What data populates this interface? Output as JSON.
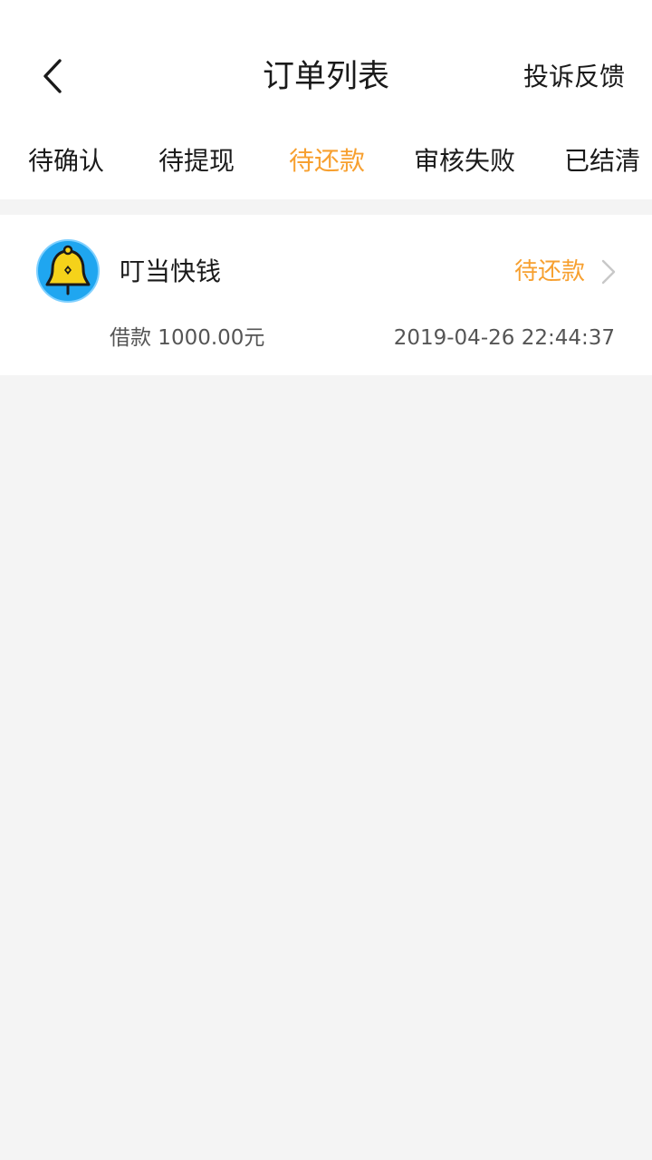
{
  "header": {
    "title": "订单列表",
    "feedback_label": "投诉反馈",
    "back_icon": "chevron-left-icon"
  },
  "tabs": [
    {
      "label": "待确认",
      "active": false
    },
    {
      "label": "待提现",
      "active": false
    },
    {
      "label": "待还款",
      "active": true
    },
    {
      "label": "审核失败",
      "active": false
    },
    {
      "label": "已结清",
      "active": false
    }
  ],
  "orders": [
    {
      "lender_name": "叮当快钱",
      "status": "待还款",
      "amount_text": "借款 1000.00元",
      "datetime": "2019-04-26 22:44:37",
      "logo_icon": "bell-logo-icon"
    }
  ],
  "colors": {
    "accent": "#f7a030",
    "background": "#f4f4f4",
    "text_primary": "#1a1a1a",
    "text_secondary": "#555555",
    "logo_blue": "#1fa6f0",
    "logo_yellow": "#f5d21a"
  }
}
